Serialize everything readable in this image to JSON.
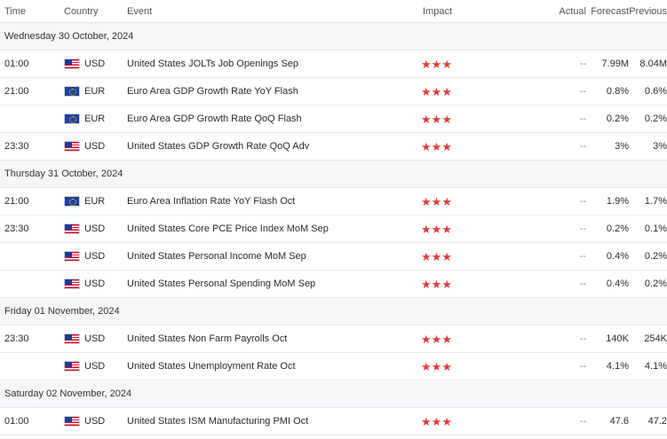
{
  "header": {
    "time": "Time",
    "country": "Country",
    "event": "Event",
    "impact": "Impact",
    "actual": "Actual",
    "forecast": "Forecast",
    "previous": "Previous"
  },
  "impact_icon": "star-icon",
  "impact_color": "#e23b3b",
  "groups": [
    {
      "date": "Wednesday 30 October, 2024",
      "rows": [
        {
          "time": "01:00",
          "flag": "us-flag-icon",
          "currency": "USD",
          "event": "United States JOLTs Job Openings Sep",
          "impact": 3,
          "actual": "--",
          "forecast": "7.99M",
          "previous": "8.04M"
        },
        {
          "time": "21:00",
          "flag": "eu-flag-icon",
          "currency": "EUR",
          "event": "Euro Area GDP Growth Rate YoY Flash",
          "impact": 3,
          "actual": "--",
          "forecast": "0.8%",
          "previous": "0.6%"
        },
        {
          "time": "",
          "flag": "eu-flag-icon",
          "currency": "EUR",
          "event": "Euro Area GDP Growth Rate QoQ Flash",
          "impact": 3,
          "actual": "--",
          "forecast": "0.2%",
          "previous": "0.2%"
        },
        {
          "time": "23:30",
          "flag": "us-flag-icon",
          "currency": "USD",
          "event": "United States GDP Growth Rate QoQ Adv",
          "impact": 3,
          "actual": "--",
          "forecast": "3%",
          "previous": "3%"
        }
      ]
    },
    {
      "date": "Thursday 31 October, 2024",
      "rows": [
        {
          "time": "21:00",
          "flag": "eu-flag-icon",
          "currency": "EUR",
          "event": "Euro Area Inflation Rate YoY Flash Oct",
          "impact": 3,
          "actual": "--",
          "forecast": "1.9%",
          "previous": "1.7%"
        },
        {
          "time": "23:30",
          "flag": "us-flag-icon",
          "currency": "USD",
          "event": "United States Core PCE Price Index MoM Sep",
          "impact": 3,
          "actual": "--",
          "forecast": "0.2%",
          "previous": "0.1%"
        },
        {
          "time": "",
          "flag": "us-flag-icon",
          "currency": "USD",
          "event": "United States Personal Income MoM Sep",
          "impact": 3,
          "actual": "--",
          "forecast": "0.4%",
          "previous": "0.2%"
        },
        {
          "time": "",
          "flag": "us-flag-icon",
          "currency": "USD",
          "event": "United States Personal Spending MoM Sep",
          "impact": 3,
          "actual": "--",
          "forecast": "0.4%",
          "previous": "0.2%"
        }
      ]
    },
    {
      "date": "Friday 01 November, 2024",
      "rows": [
        {
          "time": "23:30",
          "flag": "us-flag-icon",
          "currency": "USD",
          "event": "United States Non Farm Payrolls Oct",
          "impact": 3,
          "actual": "--",
          "forecast": "140K",
          "previous": "254K"
        },
        {
          "time": "",
          "flag": "us-flag-icon",
          "currency": "USD",
          "event": "United States Unemployment Rate Oct",
          "impact": 3,
          "actual": "--",
          "forecast": "4.1%",
          "previous": "4.1%"
        }
      ]
    },
    {
      "date": "Saturday 02 November, 2024",
      "rows": [
        {
          "time": "01:00",
          "flag": "us-flag-icon",
          "currency": "USD",
          "event": "United States ISM Manufacturing PMI Oct",
          "impact": 3,
          "actual": "--",
          "forecast": "47.6",
          "previous": "47.2"
        }
      ]
    }
  ]
}
